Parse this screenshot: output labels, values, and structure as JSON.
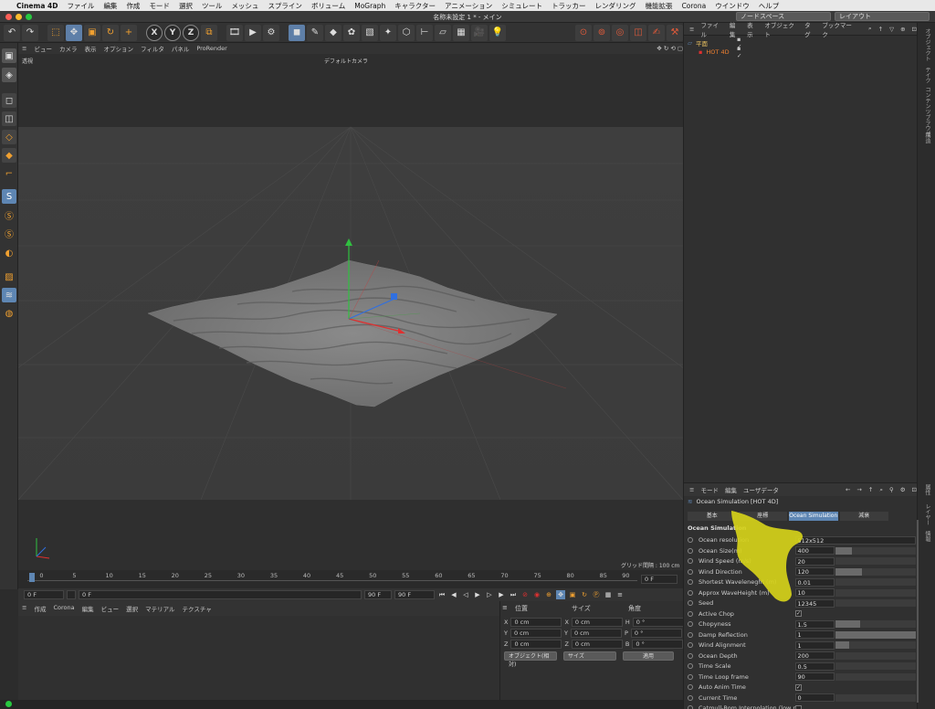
{
  "menubar": {
    "app": "Cinema 4D",
    "items": [
      "ファイル",
      "編集",
      "作成",
      "モード",
      "選択",
      "ツール",
      "メッシュ",
      "スプライン",
      "ボリューム",
      "MoGraph",
      "キャラクター",
      "アニメーション",
      "シミュレート",
      "トラッカー",
      "レンダリング",
      "機能拡張",
      "Corona",
      "ウインドウ",
      "ヘルプ"
    ]
  },
  "window": {
    "title": "名称未設定 1 * - メイン",
    "nodespace": "ノードスペース",
    "layout": "レイアウト"
  },
  "viewport": {
    "menu": [
      "ビュー",
      "カメラ",
      "表示",
      "オプション",
      "フィルタ",
      "パネル",
      "ProRender"
    ],
    "projection": "透視",
    "camera": "デフォルトカメラ",
    "grid_info": "グリッド間隔 : 100 cm"
  },
  "timeline": {
    "ticks": [
      "0",
      "5",
      "10",
      "15",
      "20",
      "25",
      "30",
      "35",
      "40",
      "45",
      "50",
      "55",
      "60",
      "65",
      "70",
      "75",
      "80",
      "85",
      "90"
    ],
    "current_frame": "0 F",
    "start": "0 F",
    "min": "0 F",
    "max": "90 F",
    "end": "90 F"
  },
  "material": {
    "menu": [
      "作成",
      "Corona",
      "編集",
      "ビュー",
      "選択",
      "マテリアル",
      "テクスチャ"
    ]
  },
  "coords": {
    "headers": [
      "位置",
      "サイズ",
      "角度"
    ],
    "rows": [
      {
        "axis": "X",
        "pos": "0 cm",
        "saxis": "X",
        "size": "0 cm",
        "raxis": "H",
        "rot": "0 °"
      },
      {
        "axis": "Y",
        "pos": "0 cm",
        "saxis": "Y",
        "size": "0 cm",
        "raxis": "P",
        "rot": "0 °"
      },
      {
        "axis": "Z",
        "pos": "0 cm",
        "saxis": "Z",
        "size": "0 cm",
        "raxis": "B",
        "rot": "0 °"
      }
    ],
    "mode": "オブジェクト(相対)",
    "size_mode": "サイズ",
    "apply": "適用"
  },
  "objects": {
    "menu": [
      "ファイル",
      "編集",
      "表示",
      "オブジェクト",
      "タグ",
      "ブックマーク"
    ],
    "items": [
      {
        "name": "平面",
        "color": "#e8c060"
      },
      {
        "name": "HOT 4D",
        "color": "#f08030"
      }
    ]
  },
  "sidetabs": [
    "オブジェクト",
    "テイク",
    "コンテンツブラウザ",
    "構造",
    "属性",
    "レイヤー",
    "情報"
  ],
  "attributes": {
    "menu": [
      "モード",
      "編集",
      "ユーザデータ"
    ],
    "title": "Ocean Simulation [HOT 4D]",
    "tabs": [
      "基本",
      "座標",
      "Ocean Simulation",
      "減衰"
    ],
    "section": "Ocean Simulation",
    "params": [
      {
        "label": "Ocean resolution",
        "value": "512x512",
        "type": "select"
      },
      {
        "label": "Ocean Size(m)",
        "value": "400",
        "type": "num",
        "fill": 0.2
      },
      {
        "label": "Wind Speed (m/s)",
        "value": "20",
        "type": "num"
      },
      {
        "label": "Wind Direction",
        "value": "120",
        "type": "num",
        "fill": 0.33
      },
      {
        "label": "Shortest Waveleneght (m)",
        "value": "0.01",
        "type": "num"
      },
      {
        "label": "Approx WaveHeight (m)",
        "value": "10",
        "type": "num"
      },
      {
        "label": "Seed",
        "value": "12345",
        "type": "num"
      },
      {
        "label": "Active Chop",
        "value": "✓",
        "type": "check"
      },
      {
        "label": "Chopyness",
        "value": "1.5",
        "type": "num",
        "fill": 0.3
      },
      {
        "label": "Damp Reflection",
        "value": "1",
        "type": "num",
        "fill": 1.0
      },
      {
        "label": "Wind Alignment",
        "value": "1",
        "type": "num",
        "fill": 0.17
      },
      {
        "label": "Ocean Depth",
        "value": "200",
        "type": "num"
      },
      {
        "label": "Time Scale",
        "value": "0.5",
        "type": "num"
      },
      {
        "label": "Time Loop frame",
        "value": "90",
        "type": "num"
      },
      {
        "label": "Auto Anim Time",
        "value": "✓",
        "type": "check"
      },
      {
        "label": "Current Time",
        "value": "0",
        "type": "num"
      },
      {
        "label": "Catmull-Rom Interpolation (low rez)",
        "value": "",
        "type": "check"
      }
    ]
  },
  "colors": {
    "accent": "#5e86b3",
    "highlight": "#d6d21a",
    "axis_x": "#e03030",
    "axis_y": "#30c040",
    "axis_z": "#3070e0"
  }
}
